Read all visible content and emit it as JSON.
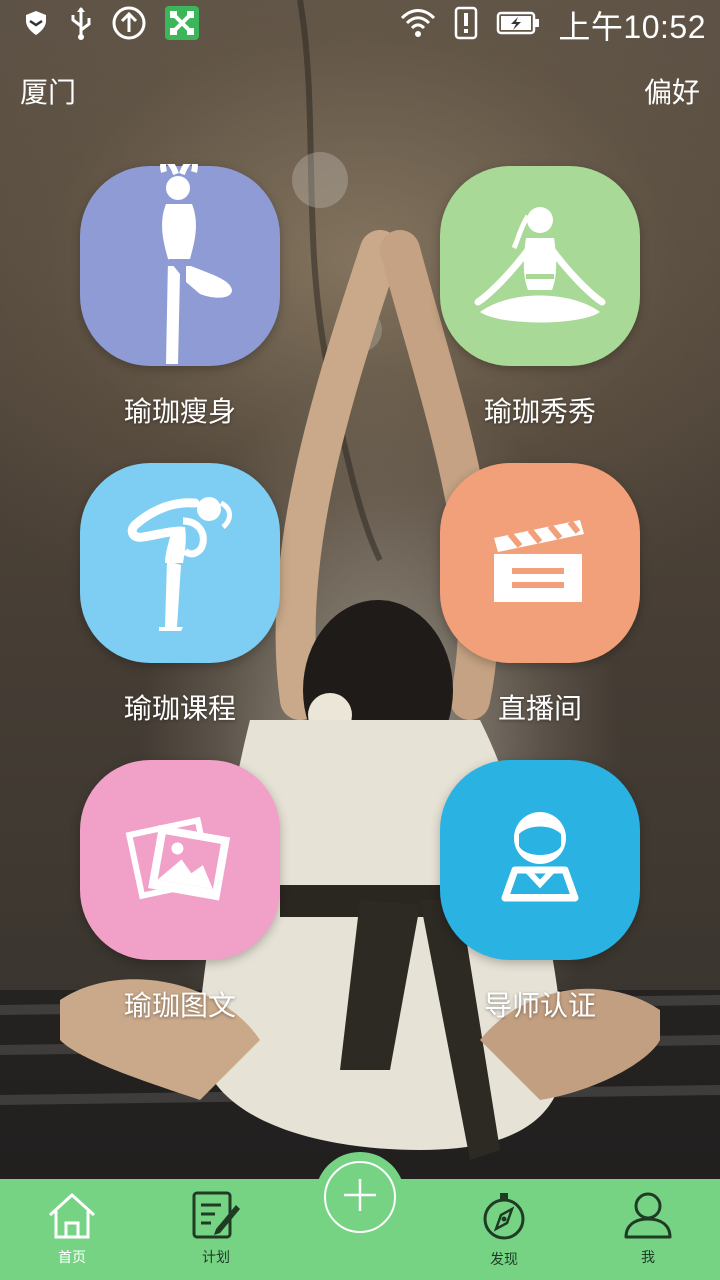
{
  "status_bar": {
    "time": "上午10:52",
    "icons": [
      "shield-icon",
      "usb-icon",
      "upload-icon",
      "app-icon",
      "wifi-icon",
      "alert-icon",
      "battery-charging-icon"
    ]
  },
  "header": {
    "location": "厦门",
    "preferences": "偏好"
  },
  "tiles": [
    {
      "label": "瑜珈瘦身",
      "icon": "yoga-tree-pose-icon",
      "color": "#8e9bd4"
    },
    {
      "label": "瑜珈秀秀",
      "icon": "yoga-lotus-pose-icon",
      "color": "#a8d996"
    },
    {
      "label": "瑜珈课程",
      "icon": "yoga-dancer-pose-icon",
      "color": "#7ecdf2"
    },
    {
      "label": "直播间",
      "icon": "clapperboard-icon",
      "color": "#f2a07a"
    },
    {
      "label": "瑜珈图文",
      "icon": "photo-gallery-icon",
      "color": "#f1a0c8"
    },
    {
      "label": "导师认证",
      "icon": "instructor-icon",
      "color": "#2ab3e2"
    }
  ],
  "tab_bar": {
    "color": "#76d384",
    "tabs": [
      {
        "label": "首页",
        "icon": "home-icon",
        "active": true
      },
      {
        "label": "计划",
        "icon": "plan-icon"
      },
      {
        "label": "发现",
        "icon": "compass-icon"
      },
      {
        "label": "我",
        "icon": "profile-icon"
      }
    ],
    "center_action": "plus-icon"
  }
}
